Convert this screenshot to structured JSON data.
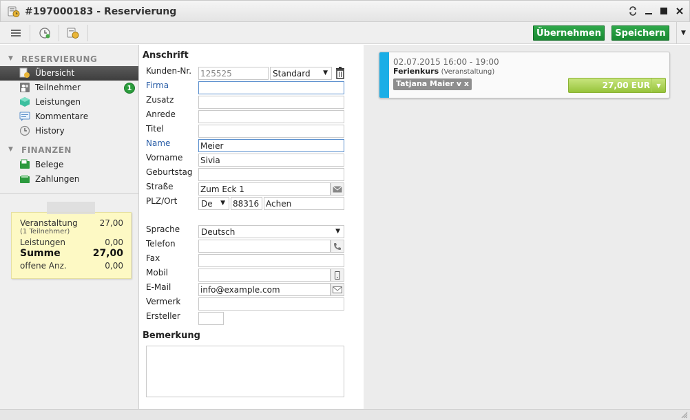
{
  "window": {
    "title": "#197000183 - Reservierung"
  },
  "toolbar": {
    "apply_label": "Übernehmen",
    "save_label": "Speichern",
    "colors": {
      "green": "#198a32"
    }
  },
  "sidebar": {
    "section_reservierung": "RESERVIERUNG",
    "section_finanzen": "FINANZEN",
    "items": [
      {
        "label": "Übersicht",
        "icon": "overview-icon"
      },
      {
        "label": "Teilnehmer",
        "icon": "participants-icon",
        "badge": "1"
      },
      {
        "label": "Leistungen",
        "icon": "services-icon"
      },
      {
        "label": "Kommentare",
        "icon": "comments-icon"
      },
      {
        "label": "History",
        "icon": "history-icon"
      }
    ],
    "finance_items": [
      {
        "label": "Belege",
        "icon": "receipts-icon"
      },
      {
        "label": "Zahlungen",
        "icon": "payments-icon"
      }
    ],
    "summary": {
      "rows": [
        {
          "label": "Veranstaltung",
          "sub": "(1 Teilnehmer)",
          "value": "27,00"
        },
        {
          "label": "Leistungen",
          "value": "0,00"
        },
        {
          "label": "Summe",
          "value": "27,00"
        },
        {
          "label": "offene Anz.",
          "value": "0,00"
        }
      ]
    }
  },
  "form": {
    "heading_address": "Anschrift",
    "heading_remark": "Bemerkung",
    "labels": {
      "kundennr": "Kunden-Nr.",
      "firma": "Firma",
      "zusatz": "Zusatz",
      "anrede": "Anrede",
      "titel": "Titel",
      "name": "Name",
      "vorname": "Vorname",
      "geburtstag": "Geburtstag",
      "strasse": "Straße",
      "plzort": "PLZ/Ort",
      "sprache": "Sprache",
      "telefon": "Telefon",
      "fax": "Fax",
      "mobil": "Mobil",
      "email": "E-Mail",
      "vermerk": "Vermerk",
      "ersteller": "Ersteller"
    },
    "values": {
      "kundennr": "125525",
      "kundentyp": "Standard",
      "firma": "",
      "zusatz": "",
      "anrede": "",
      "titel": "",
      "name": "Meier",
      "vorname": "Sivia",
      "geburtstag": "",
      "strasse": "Zum Eck 1",
      "land": "De",
      "plz": "88316",
      "ort": "Achen",
      "sprache": "Deutsch",
      "telefon": "",
      "fax": "",
      "mobil": "",
      "email": "info@example.com",
      "vermerk": "",
      "ersteller": "",
      "bemerkung": ""
    }
  },
  "booking": {
    "datetime": "02.07.2015 16:00 - 19:00",
    "title": "Ferienkurs",
    "subtitle": "(Veranstaltung)",
    "person": "Tatjana Maier v x",
    "price": "27,00 EUR",
    "stripe_color": "#1aaee6",
    "price_color": "#97c43b"
  }
}
